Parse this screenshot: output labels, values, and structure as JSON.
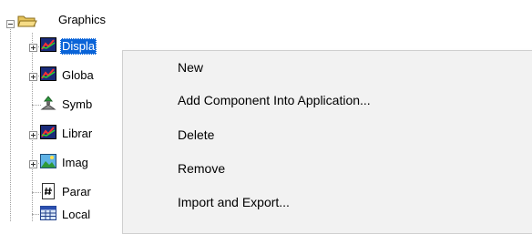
{
  "tree": {
    "root": {
      "label": "Graphics",
      "icon": "open-folder-icon",
      "expanded": true
    },
    "children": [
      {
        "label": "Displa",
        "icon": "display-chart-icon",
        "expander": "plus",
        "selected": true
      },
      {
        "label": "Globa",
        "icon": "display-chart-icon",
        "expander": "plus"
      },
      {
        "label": "Symb",
        "icon": "symbol-icon",
        "expander": "none"
      },
      {
        "label": "Librar",
        "icon": "display-chart-icon",
        "expander": "plus"
      },
      {
        "label": "Imag",
        "icon": "image-icon",
        "expander": "plus"
      },
      {
        "label": "Parar",
        "icon": "parameter-hash-icon",
        "expander": "none"
      },
      {
        "label": "Local",
        "icon": "local-table-icon",
        "expander": "none"
      }
    ]
  },
  "context_menu": {
    "items": [
      {
        "label": "New"
      },
      {
        "label": "Add Component Into Application..."
      },
      {
        "label": "Delete"
      },
      {
        "label": "Remove"
      },
      {
        "label": "Import and Export..."
      }
    ]
  },
  "colors": {
    "selection": "#0a64d8",
    "menu_background": "#f2f2f2"
  }
}
